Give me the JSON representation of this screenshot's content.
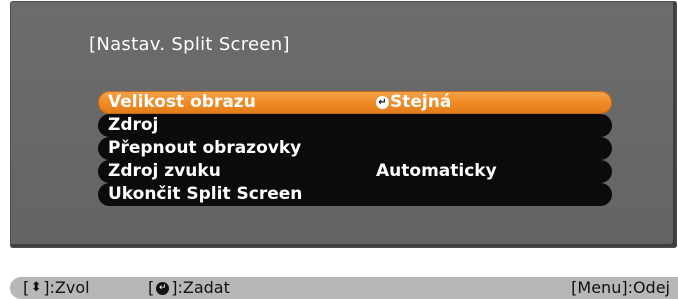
{
  "menu": {
    "title": "[Nastav. Split Screen]",
    "items": [
      {
        "label": "Velikost obrazu",
        "value": "Stejná",
        "selected": true,
        "enter_icon": "enter-icon"
      },
      {
        "label": "Zdroj",
        "value": ""
      },
      {
        "label": "Přepnout obrazovky",
        "value": ""
      },
      {
        "label": "Zdroj zvuku",
        "value": "Automaticky"
      },
      {
        "label": "Ukončit Split Screen",
        "value": ""
      }
    ]
  },
  "status_bar": {
    "nav_open": "[",
    "nav_icon": "up-down-arrows-icon",
    "nav_text": "]:Zvol",
    "enter_open": "[",
    "enter_icon": "enter-icon",
    "enter_text": "]:Zadat",
    "menu_text": "[Menu]:Odej"
  },
  "colors": {
    "panel": "#666666",
    "item_background": "#0b0b0b",
    "selected_item": "#f08a24",
    "status_bar": "#b7b7b7"
  }
}
